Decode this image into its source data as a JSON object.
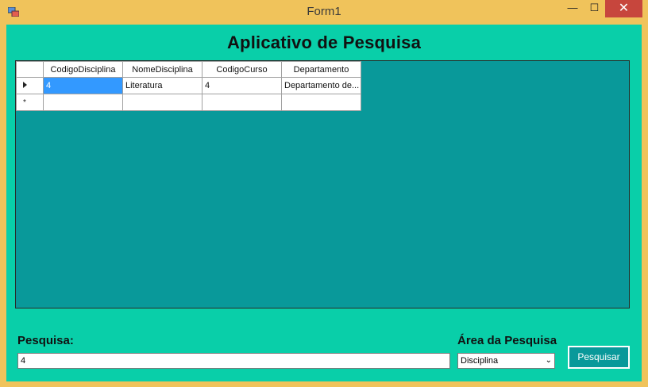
{
  "window": {
    "title": "Form1",
    "minimize_glyph": "—",
    "maximize_glyph": "☐",
    "close_glyph": "✕"
  },
  "header": {
    "title": "Aplicativo de Pesquisa"
  },
  "grid": {
    "columns": [
      "CodigoDisciplina",
      "NomeDisciplina",
      "CodigoCurso",
      "Departamento"
    ],
    "rows": [
      [
        "4",
        "Literatura",
        "4",
        "Departamento de..."
      ]
    ],
    "new_row_marker": "*"
  },
  "search": {
    "label": "Pesquisa:",
    "value": "4"
  },
  "area": {
    "label": "Área da Pesquisa",
    "selected": "Disciplina"
  },
  "actions": {
    "search_label": "Pesquisar"
  },
  "colors": {
    "titlebar": "#f0c35b",
    "client_bg": "#09cfa9",
    "grid_bg": "#09999a",
    "close_btn": "#c7463d",
    "selection": "#3399ff"
  }
}
